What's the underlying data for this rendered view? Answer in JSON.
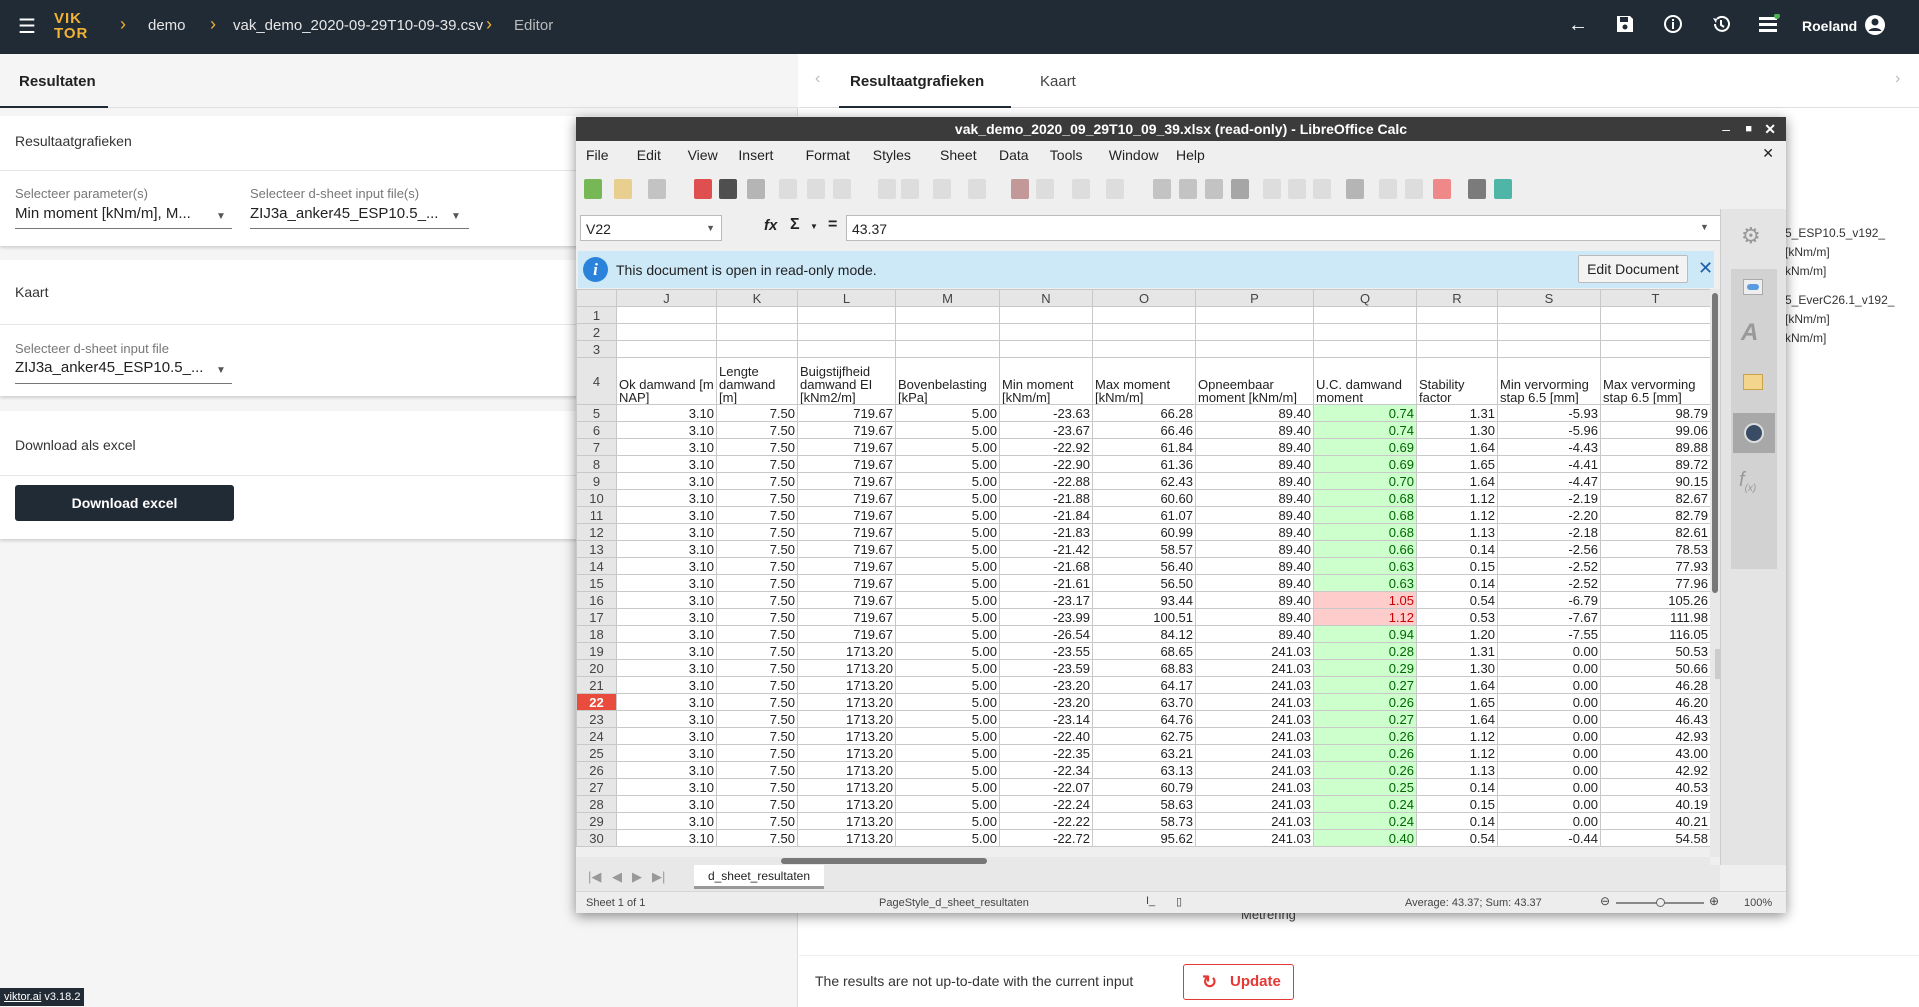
{
  "topbar": {
    "logo": "VIKTOR",
    "breadcrumb": [
      "demo",
      "vak_demo_2020-09-29T10-09-39.csv",
      "Editor"
    ],
    "user": "Roeland",
    "icons": [
      "menu-icon",
      "back-arrow-icon",
      "save-icon",
      "info-icon",
      "history-icon",
      "list-icon",
      "user-icon"
    ]
  },
  "left": {
    "tab": "Resultaten",
    "section1": {
      "title": "Resultaatgrafieken",
      "param_label": "Selecteer parameter(s)",
      "param_value": "Min moment [kNm/m], M...",
      "file_label": "Selecteer d-sheet input file(s)",
      "file_value": "ZIJ3a_anker45_ESP10.5_..."
    },
    "section2": {
      "title": "Kaart",
      "file_label": "Selecteer d-sheet input file",
      "file_value": "ZIJ3a_anker45_ESP10.5_..."
    },
    "section3": {
      "title": "Download als excel",
      "button": "Download excel"
    },
    "version_link": "viktor.ai",
    "version": "v3.18.2"
  },
  "right": {
    "tabs": [
      "Resultaatgrafieken",
      "Kaart"
    ],
    "bg_lines": [
      "5_ESP10.5_v192_",
      "[kNm/m]",
      "kNm/m]",
      "5_EverC26.1_v192_",
      "[kNm/m]",
      "kNm/m]"
    ],
    "metrering": "Metrering",
    "notice": "The results are not up-to-date with the current input",
    "update": "Update"
  },
  "calc": {
    "title": "vak_demo_2020_09_29T10_09_39.xlsx (read-only) - LibreOffice Calc",
    "menu": [
      "File",
      "Edit",
      "View",
      "Insert",
      "Format",
      "Styles",
      "Sheet",
      "Data",
      "Tools",
      "Window",
      "Help"
    ],
    "name_box": "V22",
    "formula": "43.37",
    "infobar": "This document is open in read-only mode.",
    "edit_button": "Edit Document",
    "columns": [
      "J",
      "K",
      "L",
      "M",
      "N",
      "O",
      "P",
      "Q",
      "R",
      "S",
      "T"
    ],
    "headers": [
      "Ok damwand [m NAP]",
      "Lengte damwand [m]",
      "Buigstijfheid damwand EI [kNm2/m]",
      "Bovenbelasting [kPa]",
      "Min moment [kNm/m]",
      "Max moment [kNm/m]",
      "Opneembaar moment [kNm/m]",
      "U.C. damwand moment",
      "Stability factor",
      "Min vervorming stap 6.5 [mm]",
      "Max vervorming stap 6.5 [mm]"
    ],
    "selected_row": 22,
    "rows": [
      [
        "3.10",
        "7.50",
        "719.67",
        "5.00",
        "-23.63",
        "66.28",
        "89.40",
        "0.74",
        "1.31",
        "-5.93",
        "98.79"
      ],
      [
        "3.10",
        "7.50",
        "719.67",
        "5.00",
        "-23.67",
        "66.46",
        "89.40",
        "0.74",
        "1.30",
        "-5.96",
        "99.06"
      ],
      [
        "3.10",
        "7.50",
        "719.67",
        "5.00",
        "-22.92",
        "61.84",
        "89.40",
        "0.69",
        "1.64",
        "-4.43",
        "89.88"
      ],
      [
        "3.10",
        "7.50",
        "719.67",
        "5.00",
        "-22.90",
        "61.36",
        "89.40",
        "0.69",
        "1.65",
        "-4.41",
        "89.72"
      ],
      [
        "3.10",
        "7.50",
        "719.67",
        "5.00",
        "-22.88",
        "62.43",
        "89.40",
        "0.70",
        "1.64",
        "-4.47",
        "90.15"
      ],
      [
        "3.10",
        "7.50",
        "719.67",
        "5.00",
        "-21.88",
        "60.60",
        "89.40",
        "0.68",
        "1.12",
        "-2.19",
        "82.67"
      ],
      [
        "3.10",
        "7.50",
        "719.67",
        "5.00",
        "-21.84",
        "61.07",
        "89.40",
        "0.68",
        "1.12",
        "-2.20",
        "82.79"
      ],
      [
        "3.10",
        "7.50",
        "719.67",
        "5.00",
        "-21.83",
        "60.99",
        "89.40",
        "0.68",
        "1.13",
        "-2.18",
        "82.61"
      ],
      [
        "3.10",
        "7.50",
        "719.67",
        "5.00",
        "-21.42",
        "58.57",
        "89.40",
        "0.66",
        "0.14",
        "-2.56",
        "78.53"
      ],
      [
        "3.10",
        "7.50",
        "719.67",
        "5.00",
        "-21.68",
        "56.40",
        "89.40",
        "0.63",
        "0.15",
        "-2.52",
        "77.93"
      ],
      [
        "3.10",
        "7.50",
        "719.67",
        "5.00",
        "-21.61",
        "56.50",
        "89.40",
        "0.63",
        "0.14",
        "-2.52",
        "77.96"
      ],
      [
        "3.10",
        "7.50",
        "719.67",
        "5.00",
        "-23.17",
        "93.44",
        "89.40",
        "1.05",
        "0.54",
        "-6.79",
        "105.26"
      ],
      [
        "3.10",
        "7.50",
        "719.67",
        "5.00",
        "-23.99",
        "100.51",
        "89.40",
        "1.12",
        "0.53",
        "-7.67",
        "111.98"
      ],
      [
        "3.10",
        "7.50",
        "719.67",
        "5.00",
        "-26.54",
        "84.12",
        "89.40",
        "0.94",
        "1.20",
        "-7.55",
        "116.05"
      ],
      [
        "3.10",
        "7.50",
        "1713.20",
        "5.00",
        "-23.55",
        "68.65",
        "241.03",
        "0.28",
        "1.31",
        "0.00",
        "50.53"
      ],
      [
        "3.10",
        "7.50",
        "1713.20",
        "5.00",
        "-23.59",
        "68.83",
        "241.03",
        "0.29",
        "1.30",
        "0.00",
        "50.66"
      ],
      [
        "3.10",
        "7.50",
        "1713.20",
        "5.00",
        "-23.20",
        "64.17",
        "241.03",
        "0.27",
        "1.64",
        "0.00",
        "46.28"
      ],
      [
        "3.10",
        "7.50",
        "1713.20",
        "5.00",
        "-23.20",
        "63.70",
        "241.03",
        "0.26",
        "1.65",
        "0.00",
        "46.20"
      ],
      [
        "3.10",
        "7.50",
        "1713.20",
        "5.00",
        "-23.14",
        "64.76",
        "241.03",
        "0.27",
        "1.64",
        "0.00",
        "46.43"
      ],
      [
        "3.10",
        "7.50",
        "1713.20",
        "5.00",
        "-22.40",
        "62.75",
        "241.03",
        "0.26",
        "1.12",
        "0.00",
        "42.93"
      ],
      [
        "3.10",
        "7.50",
        "1713.20",
        "5.00",
        "-22.35",
        "63.21",
        "241.03",
        "0.26",
        "1.12",
        "0.00",
        "43.00"
      ],
      [
        "3.10",
        "7.50",
        "1713.20",
        "5.00",
        "-22.34",
        "63.13",
        "241.03",
        "0.26",
        "1.13",
        "0.00",
        "42.92"
      ],
      [
        "3.10",
        "7.50",
        "1713.20",
        "5.00",
        "-22.07",
        "60.79",
        "241.03",
        "0.25",
        "0.14",
        "0.00",
        "40.53"
      ],
      [
        "3.10",
        "7.50",
        "1713.20",
        "5.00",
        "-22.24",
        "58.63",
        "241.03",
        "0.24",
        "0.15",
        "0.00",
        "40.19"
      ],
      [
        "3.10",
        "7.50",
        "1713.20",
        "5.00",
        "-22.22",
        "58.73",
        "241.03",
        "0.24",
        "0.14",
        "0.00",
        "40.21"
      ],
      [
        "3.10",
        "7.50",
        "1713.20",
        "5.00",
        "-22.72",
        "95.62",
        "241.03",
        "0.40",
        "0.54",
        "-0.44",
        "54.58"
      ]
    ],
    "sheet_tab": "d_sheet_resultaten",
    "status": {
      "sheet": "Sheet 1 of 1",
      "page_style": "PageStyle_d_sheet_resultaten",
      "summary": "Average: 43.37; Sum: 43.37",
      "zoom": "100%"
    },
    "colors": {
      "uc_ok_bg": "#ccffcc",
      "uc_bad_bg": "#ffcccc",
      "selected_row": "#e94b3c",
      "accent": "#f2b233",
      "update_red": "#e53935"
    }
  }
}
